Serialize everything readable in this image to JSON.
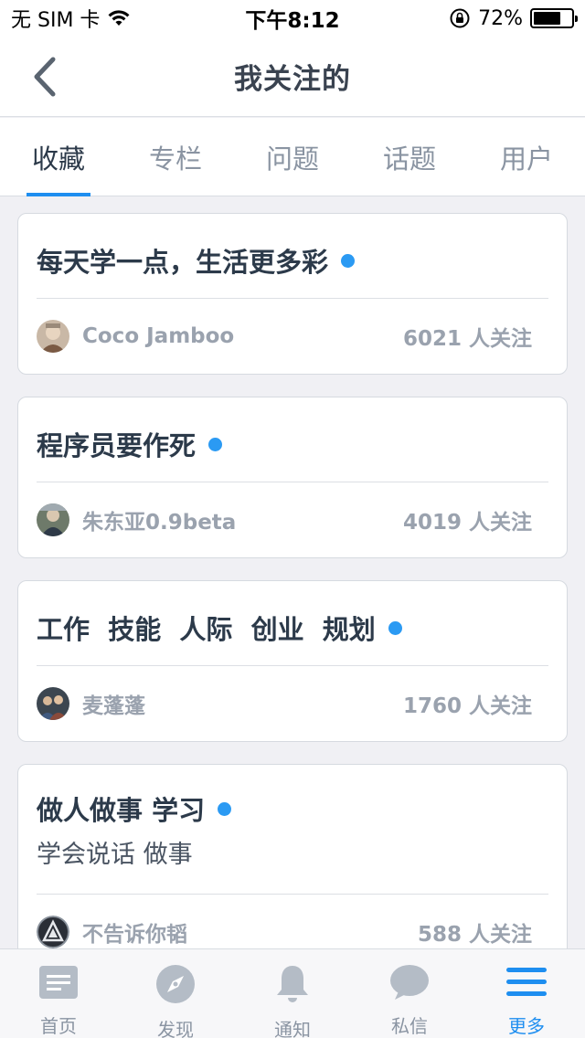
{
  "status_bar": {
    "carrier": "无 SIM 卡",
    "time": "下午8:12",
    "battery": "72%",
    "battery_level": 0.72
  },
  "nav": {
    "title": "我关注的"
  },
  "tabs": [
    {
      "label": "收藏",
      "active": true
    },
    {
      "label": "专栏",
      "active": false
    },
    {
      "label": "问题",
      "active": false
    },
    {
      "label": "话题",
      "active": false
    },
    {
      "label": "用户",
      "active": false
    }
  ],
  "cards": [
    {
      "title": "每天学一点，生活更多彩",
      "description": "",
      "author": "Coco Jamboo",
      "followers": "6021 人关注"
    },
    {
      "title": "程序员要作死",
      "description": "",
      "author": "朱东亚0.9beta",
      "followers": "4019 人关注"
    },
    {
      "title": "工作  技能  人际  创业  规划",
      "description": "",
      "author": "麦蓬蓬",
      "followers": "1760 人关注"
    },
    {
      "title": "做人做事 学习",
      "description": "学会说话 做事",
      "author": "不告诉你韬",
      "followers": "588 人关注"
    }
  ],
  "tab_bar": [
    {
      "label": "首页",
      "icon": "home-icon",
      "active": false
    },
    {
      "label": "发现",
      "icon": "compass-icon",
      "active": false
    },
    {
      "label": "通知",
      "icon": "bell-icon",
      "active": false
    },
    {
      "label": "私信",
      "icon": "chat-bubble-icon",
      "active": false
    },
    {
      "label": "更多",
      "icon": "menu-icon",
      "active": true
    }
  ],
  "colors": {
    "accent": "#1e8ef0",
    "dot": "#2b9af3",
    "background": "#f0f0f4"
  }
}
